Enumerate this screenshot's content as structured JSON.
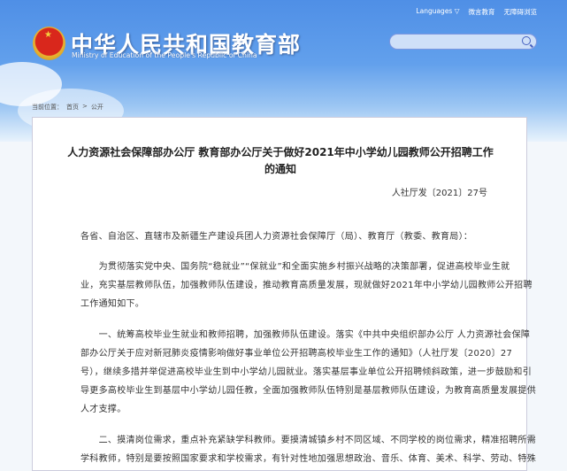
{
  "header": {
    "languages": "Languages ▽",
    "weibo": "微言教育",
    "accessibility": "无障碍浏览",
    "title_cn": "中华人民共和国教育部",
    "title_en": "Ministry of Education of the People's Republic of China",
    "search_placeholder": ""
  },
  "breadcrumb": {
    "label": "当前位置：",
    "home": "首页",
    "sep": ">",
    "current": "公开"
  },
  "article": {
    "title_line1": "人力资源社会保障部办公厅 教育部办公厅关于做好2021年中小学幼儿园教师公开招聘工作",
    "title_line2": "的通知",
    "doc_no": "人社厅发〔2021〕27号",
    "lines": [
      "各省、自治区、直辖市及新疆生产建设兵团人力资源社会保障厅（局）、教育厅（教委、教育局）：",
      "　　为贯彻落实党中央、国务院“稳就业”“保就业”和全面实施乡村振兴战略的决策部署，促进高校毕业生就",
      "业，充实基层教师队伍，加强教师队伍建设，推动教育高质量发展，现就做好2021年中小学幼儿园教师公开招聘",
      "工作通知如下。",
      "　　一、统筹高校毕业生就业和教师招聘，加强教师队伍建设。落实《中共中央组织部办公厅 人力资源社会保障",
      "部办公厅关于应对新冠肺炎疫情影响做好事业单位公开招聘高校毕业生工作的通知》（人社厅发〔2020〕27",
      "号），继续多措并举促进高校毕业生到中小学幼儿园就业。落实基层事业单位公开招聘倾斜政策，进一步鼓励和引",
      "导更多高校毕业生到基层中小学幼儿园任教，全面加强教师队伍特别是基层教师队伍建设，为教育高质量发展提供",
      "人才支撑。",
      "　　二、摸清岗位需求，重点补充紧缺学科教师。要摸清城镇乡村不同区域、不同学校的岗位需求，精准招聘所需",
      "学科教师，特别是要按照国家要求和学校需求，有针对性地加强思想政治、音乐、体育、美术、科学、劳动、特殊"
    ]
  }
}
